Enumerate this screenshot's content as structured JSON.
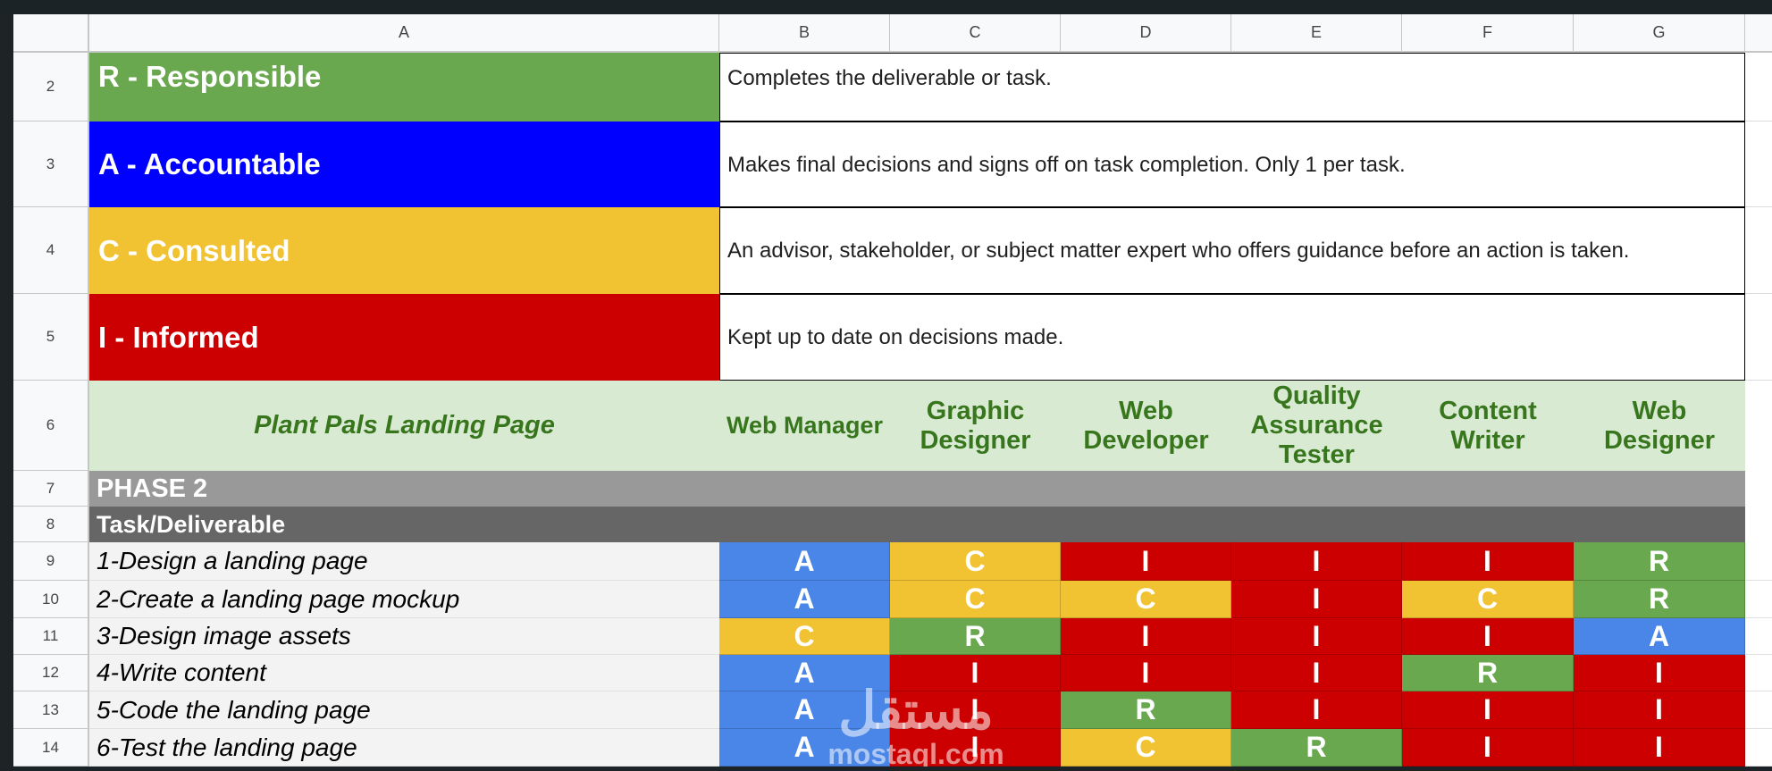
{
  "columns": [
    "A",
    "B",
    "C",
    "D",
    "E",
    "F",
    "G"
  ],
  "legend": [
    {
      "row": "2",
      "role": "R - Responsible",
      "description": "Completes the deliverable or task.",
      "color": "#6aa84f"
    },
    {
      "row": "3",
      "role": "A - Accountable",
      "description": "Makes final decisions and signs off on task completion. Only 1 per task.",
      "color": "#0000ff"
    },
    {
      "row": "4",
      "role": "C - Consulted",
      "description": "An advisor, stakeholder, or subject matter expert who offers guidance before an action is taken.",
      "color": "#f1c232"
    },
    {
      "row": "5",
      "role": "I - Informed",
      "description": "Kept up to date on decisions made.",
      "color": "#cc0000"
    }
  ],
  "header": {
    "row": "6",
    "title": "Plant Pals Landing Page",
    "roles": [
      "Web Manager",
      "Graphic Designer",
      "Web Developer",
      "Quality Assurance Tester",
      "Content Writer",
      "Web Designer"
    ]
  },
  "phase": {
    "row": "7",
    "label": "PHASE 2"
  },
  "task_header": {
    "row": "8",
    "label": "Task/Deliverable"
  },
  "tasks": [
    {
      "row": "9",
      "name": "1-Design a landing page",
      "raci": [
        "A",
        "C",
        "I",
        "I",
        "I",
        "R"
      ]
    },
    {
      "row": "10",
      "name": "2-Create a landing page mockup",
      "raci": [
        "A",
        "C",
        "C",
        "I",
        "C",
        "R"
      ]
    },
    {
      "row": "11",
      "name": "3-Design image assets",
      "raci": [
        "C",
        "R",
        "I",
        "I",
        "I",
        "A"
      ]
    },
    {
      "row": "12",
      "name": "4-Write content",
      "raci": [
        "A",
        "I",
        "I",
        "I",
        "R",
        "I"
      ]
    },
    {
      "row": "13",
      "name": "5-Code the landing page",
      "raci": [
        "A",
        "I",
        "R",
        "I",
        "I",
        "I"
      ]
    },
    {
      "row": "14",
      "name": "6-Test the landing page",
      "raci": [
        "A",
        "I",
        "C",
        "R",
        "I",
        "I"
      ]
    }
  ],
  "raci_colors": {
    "A": "#4a86e8",
    "C": "#f1c232",
    "I": "#cc0000",
    "R": "#6aa84f"
  },
  "watermark": {
    "arabic": "مستقل",
    "latin": "mostaql.com"
  }
}
